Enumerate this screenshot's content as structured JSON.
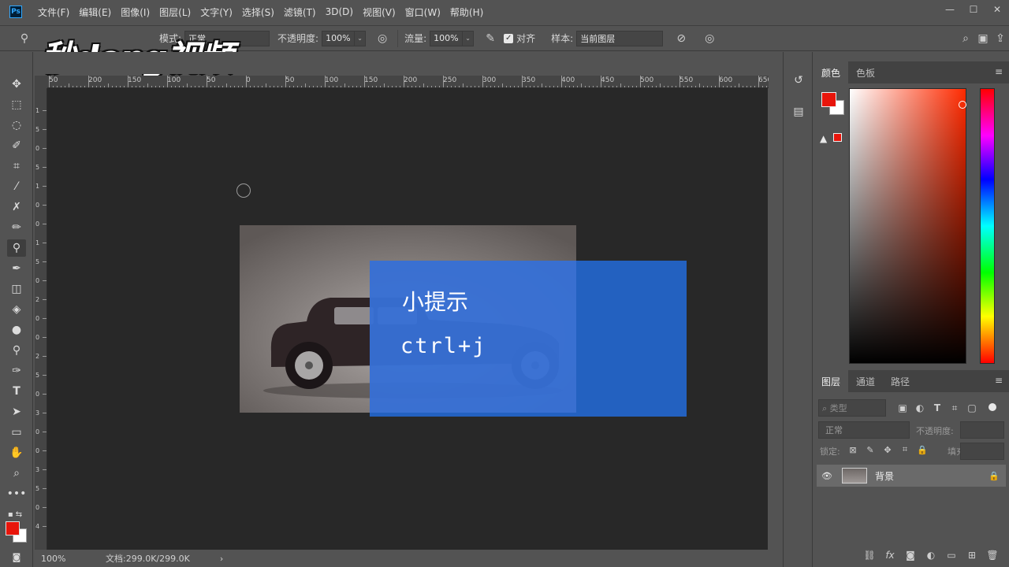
{
  "app": {
    "logo_text": "Ps"
  },
  "menu": [
    {
      "label": "文件(F)"
    },
    {
      "label": "编辑(E)"
    },
    {
      "label": "图像(I)"
    },
    {
      "label": "图层(L)"
    },
    {
      "label": "文字(Y)"
    },
    {
      "label": "选择(S)"
    },
    {
      "label": "滤镜(T)"
    },
    {
      "label": "3D(D)"
    },
    {
      "label": "视图(V)"
    },
    {
      "label": "窗口(W)"
    },
    {
      "label": "帮助(H)"
    }
  ],
  "options_bar": {
    "mode_label": "模式:",
    "mode_value": "正常",
    "opacity_label": "不透明度:",
    "opacity_value": "100%",
    "flow_label": "流量:",
    "flow_value": "100%",
    "align_label": "对齐",
    "sample_label": "样本:",
    "sample_value": "当前图层"
  },
  "watermark": {
    "text": "秒dong视频"
  },
  "ruler": {
    "top_ticks": [
      "50",
      "200",
      "150",
      "100",
      "50",
      "0",
      "50",
      "100",
      "150",
      "200",
      "250",
      "300",
      "350",
      "400",
      "450",
      "500",
      "550",
      "600",
      "650"
    ],
    "left_ticks": [
      "1",
      "5",
      "0",
      "5",
      "1",
      "0",
      "0",
      "1",
      "5",
      "0",
      "2",
      "0",
      "0",
      "2",
      "5",
      "0",
      "3",
      "0",
      "0",
      "3",
      "5",
      "0",
      "4"
    ]
  },
  "status": {
    "zoom": "100%",
    "doc": "文档:299.0K/299.0K"
  },
  "tip": {
    "title": "小提示",
    "keys": "ctrl+j"
  },
  "color_panel": {
    "tabs": [
      {
        "label": "颜色"
      },
      {
        "label": "色板"
      }
    ]
  },
  "layers_panel": {
    "tabs": [
      {
        "label": "图层"
      },
      {
        "label": "通道"
      },
      {
        "label": "路径"
      }
    ],
    "filter_placeholder": "⌕ 类型",
    "blend_mode": "正常",
    "opacity_label": "不透明度:",
    "lock_label": "锁定:",
    "fill_label": "填充:",
    "layers": [
      {
        "name": "背景"
      }
    ]
  },
  "colors": {
    "foreground": "#e8150b",
    "background": "#ffffff",
    "accent": "#2466cc"
  }
}
